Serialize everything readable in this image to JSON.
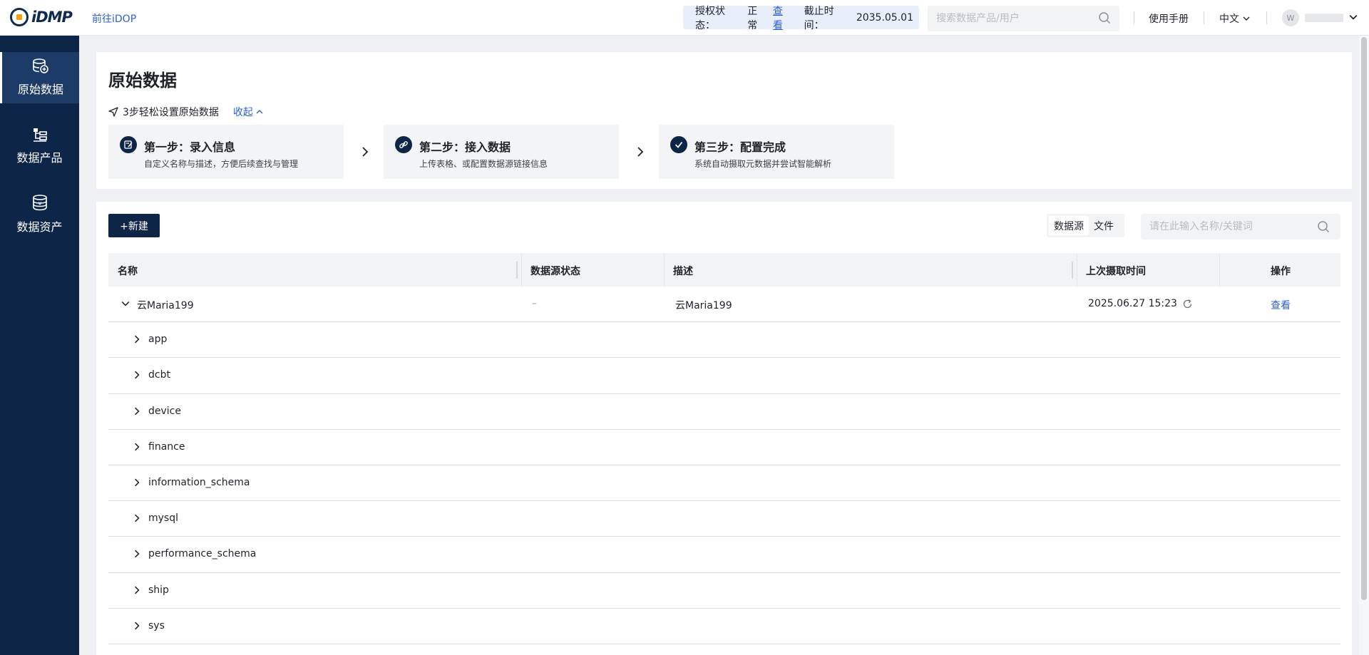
{
  "header": {
    "logo_text": "iDMP",
    "goto_link": "前往iDOP",
    "license_label": "授权状态：",
    "license_status": "正常",
    "license_view": "查看",
    "expire_label": "截止时间：",
    "expire_date": "2035.05.01",
    "search_placeholder": "搜索数据产品/用户",
    "manual": "使用手册",
    "language": "中文",
    "avatar_initial": "W"
  },
  "sidebar": {
    "items": [
      {
        "label": "原始数据",
        "icon": "database-icon",
        "active": true
      },
      {
        "label": "数据产品",
        "icon": "hierarchy-icon",
        "active": false
      },
      {
        "label": "数据资产",
        "icon": "coin-stack-icon",
        "active": false
      }
    ]
  },
  "steps_panel": {
    "title": "原始数据",
    "hint": "3步轻松设置原始数据",
    "collapse": "收起",
    "steps": [
      {
        "title": "第一步：录入信息",
        "desc": "自定义名称与描述，方便后续查找与管理",
        "icon": "edit-note-icon"
      },
      {
        "title": "第二步：接入数据",
        "desc": "上传表格、或配置数据源链接信息",
        "icon": "link-icon"
      },
      {
        "title": "第三步：配置完成",
        "desc": "系统自动摄取元数据并尝试智能解析",
        "icon": "check-icon"
      }
    ]
  },
  "list": {
    "new_button": "+新建",
    "toggle": [
      "数据源",
      "文件"
    ],
    "search_placeholder": "请在此输入名称/关键词",
    "columns": [
      "名称",
      "数据源状态",
      "描述",
      "上次摄取时间",
      "操作"
    ],
    "parent_row": {
      "name": "云Maria199",
      "status": "–",
      "desc": "云Maria199",
      "last_ingest": "2025.06.27 15:23",
      "action": "查看"
    },
    "children": [
      "app",
      "dcbt",
      "device",
      "finance",
      "information_schema",
      "mysql",
      "performance_schema",
      "ship",
      "sys"
    ]
  },
  "colors": {
    "sidebar_bg": "#0d2547",
    "accent": "#2b5fd9",
    "page_bg": "#eef0f3"
  }
}
